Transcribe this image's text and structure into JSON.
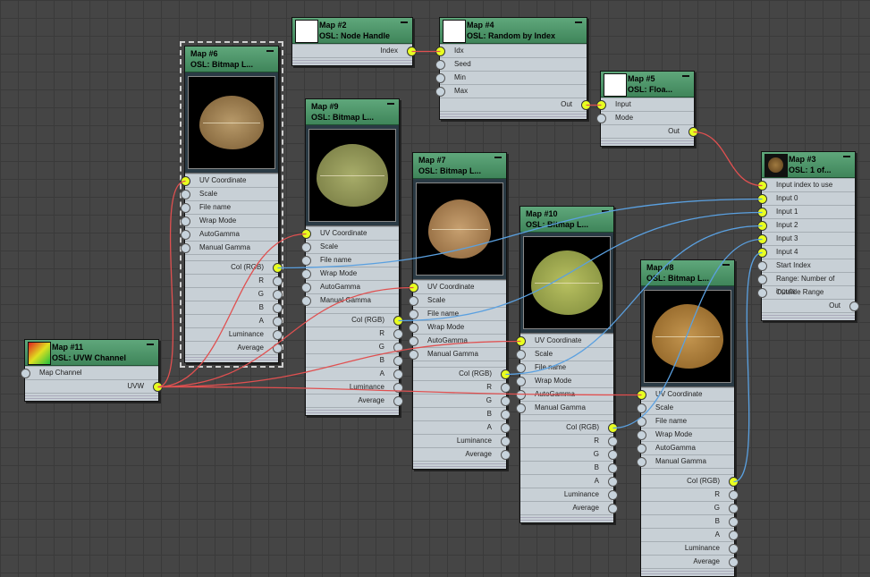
{
  "nodes": {
    "map2": {
      "title": "Map #2",
      "subtitle": "OSL: Node Handle",
      "outputs": [
        "Index"
      ]
    },
    "map4": {
      "title": "Map #4",
      "subtitle": "OSL: Random by Index",
      "inputs": [
        "Idx",
        "Seed",
        "Min",
        "Max"
      ],
      "outputs": [
        "Out"
      ]
    },
    "map5": {
      "title": "Map #5",
      "subtitle": "OSL: Floa...",
      "inputs": [
        "Input",
        "Mode"
      ],
      "outputs": [
        "Out"
      ]
    },
    "map3": {
      "title": "Map #3",
      "subtitle": "OSL: 1 of...",
      "inputs": [
        "Input index to use",
        "Input 0",
        "Input 1",
        "Input 2",
        "Input 3",
        "Input 4",
        "Start Index",
        "Range: Number of inputs",
        "Outside Range"
      ],
      "outputs": [
        "Out"
      ]
    },
    "map11": {
      "title": "Map #11",
      "subtitle": "OSL: UVW Channel",
      "inputs": [
        "Map Channel"
      ],
      "outputs": [
        "UVW"
      ]
    },
    "map6": {
      "title": "Map #6",
      "subtitle": "OSL: Bitmap L...",
      "inputs": [
        "UV Coordinate",
        "Scale",
        "File name",
        "Wrap Mode",
        "AutoGamma",
        "Manual Gamma"
      ],
      "outputs": [
        "Col (RGB)",
        "R",
        "G",
        "B",
        "A",
        "Luminance",
        "Average"
      ]
    },
    "map9": {
      "title": "Map #9",
      "subtitle": "OSL: Bitmap L...",
      "inputs": [
        "UV Coordinate",
        "Scale",
        "File name",
        "Wrap Mode",
        "AutoGamma",
        "Manual Gamma"
      ],
      "outputs": [
        "Col (RGB)",
        "R",
        "G",
        "B",
        "A",
        "Luminance",
        "Average"
      ]
    },
    "map7": {
      "title": "Map #7",
      "subtitle": "OSL: Bitmap L...",
      "inputs": [
        "UV Coordinate",
        "Scale",
        "File name",
        "Wrap Mode",
        "AutoGamma",
        "Manual Gamma"
      ],
      "outputs": [
        "Col (RGB)",
        "R",
        "G",
        "B",
        "A",
        "Luminance",
        "Average"
      ]
    },
    "map10": {
      "title": "Map #10",
      "subtitle": "OSL: Bitmap L...",
      "inputs": [
        "UV Coordinate",
        "Scale",
        "File name",
        "Wrap Mode",
        "AutoGamma",
        "Manual Gamma"
      ],
      "outputs": [
        "Col (RGB)",
        "R",
        "G",
        "B",
        "A",
        "Luminance",
        "Average"
      ]
    },
    "map8": {
      "title": "Map #8",
      "subtitle": "OSL: Bitmap L...",
      "inputs": [
        "UV Coordinate",
        "Scale",
        "File name",
        "Wrap Mode",
        "AutoGamma",
        "Manual Gamma"
      ],
      "outputs": [
        "Col (RGB)",
        "R",
        "G",
        "B",
        "A",
        "Luminance",
        "Average"
      ]
    }
  },
  "colors": {
    "header": "#4f9a6b",
    "panel": "#c8d0d6",
    "active_socket": "#e8ff20",
    "wire_red": "#e05050",
    "wire_blue": "#5aa0e0",
    "canvas": "#454545"
  }
}
